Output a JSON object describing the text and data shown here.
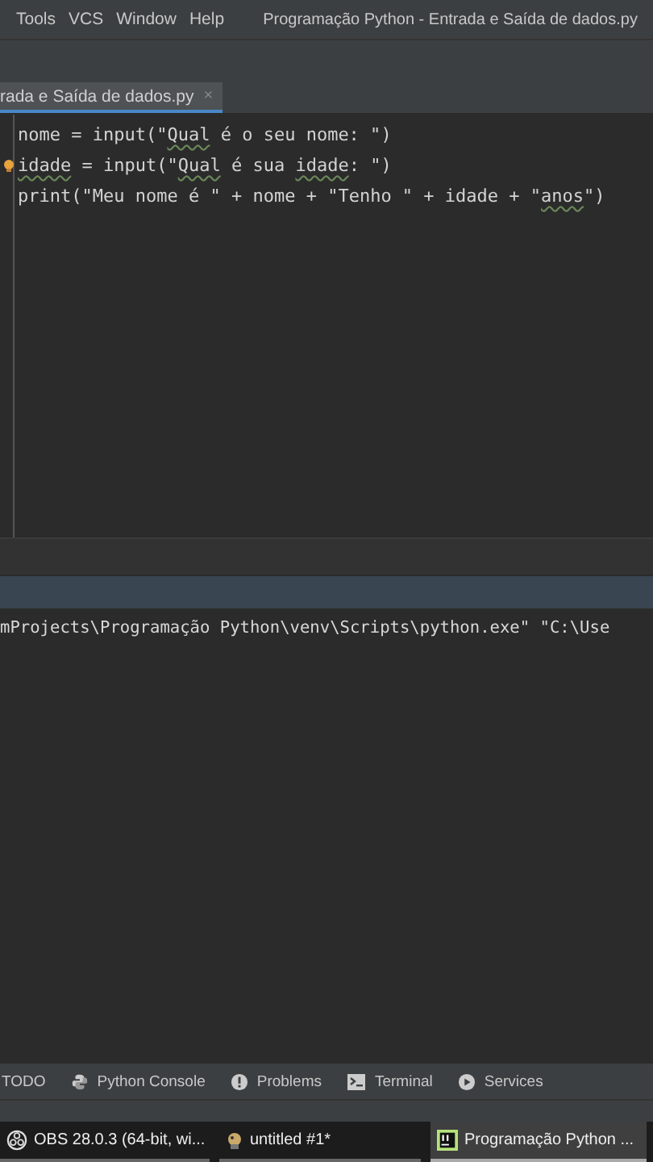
{
  "menu_bar": {
    "items": [
      "Tools",
      "VCS",
      "Window",
      "Help"
    ],
    "title": "Programação Python - Entrada e Saída de dados.py"
  },
  "editor_tabs": [
    {
      "label": "rada e Saída de dados.py",
      "close": "×",
      "selected": true
    }
  ],
  "code_lines": [
    {
      "bulb": false,
      "tokens": [
        {
          "kind": "code",
          "text": "nome = input("
        },
        {
          "kind": "string",
          "text": "\""
        },
        {
          "kind": "string-typo",
          "text": "Qual"
        },
        {
          "kind": "string",
          "text": " é o seu nome: \""
        },
        {
          "kind": "code",
          "text": ")"
        }
      ]
    },
    {
      "bulb": true,
      "tokens": [
        {
          "kind": "code-typo",
          "text": "idade"
        },
        {
          "kind": "code",
          "text": " = input("
        },
        {
          "kind": "string",
          "text": "\""
        },
        {
          "kind": "string-typo",
          "text": "Qual"
        },
        {
          "kind": "string",
          "text": " é sua "
        },
        {
          "kind": "string-typo",
          "text": "idade"
        },
        {
          "kind": "string",
          "text": ": \""
        },
        {
          "kind": "code",
          "text": ")"
        }
      ]
    },
    {
      "bulb": false,
      "tokens": [
        {
          "kind": "code",
          "text": "print("
        },
        {
          "kind": "string",
          "text": "\"Meu nome é \""
        },
        {
          "kind": "code",
          "text": " + nome + "
        },
        {
          "kind": "string",
          "text": "\"Tenho \""
        },
        {
          "kind": "code",
          "text": " + idade + "
        },
        {
          "kind": "string",
          "text": "\""
        },
        {
          "kind": "string-typo",
          "text": "anos"
        },
        {
          "kind": "string",
          "text": "\""
        },
        {
          "kind": "code",
          "text": ")"
        }
      ]
    }
  ],
  "console": {
    "lines": [
      "mProjects\\Programação Python\\venv\\Scripts\\python.exe\" \"C:\\Use"
    ]
  },
  "tool_windows": [
    {
      "kind": "todo",
      "label": "TODO"
    },
    {
      "kind": "python",
      "label": "Python Console"
    },
    {
      "kind": "problems",
      "label": "Problems"
    },
    {
      "kind": "terminal",
      "label": "Terminal"
    },
    {
      "kind": "services",
      "label": "Services"
    }
  ],
  "taskbar": [
    {
      "kind": "obs",
      "label": "OBS 28.0.3 (64-bit, wi...",
      "selected": false
    },
    {
      "kind": "paint",
      "label": "untitled #1*",
      "selected": false
    },
    {
      "kind": "pycharm",
      "label": "Programação Python ...",
      "selected": true
    }
  ]
}
